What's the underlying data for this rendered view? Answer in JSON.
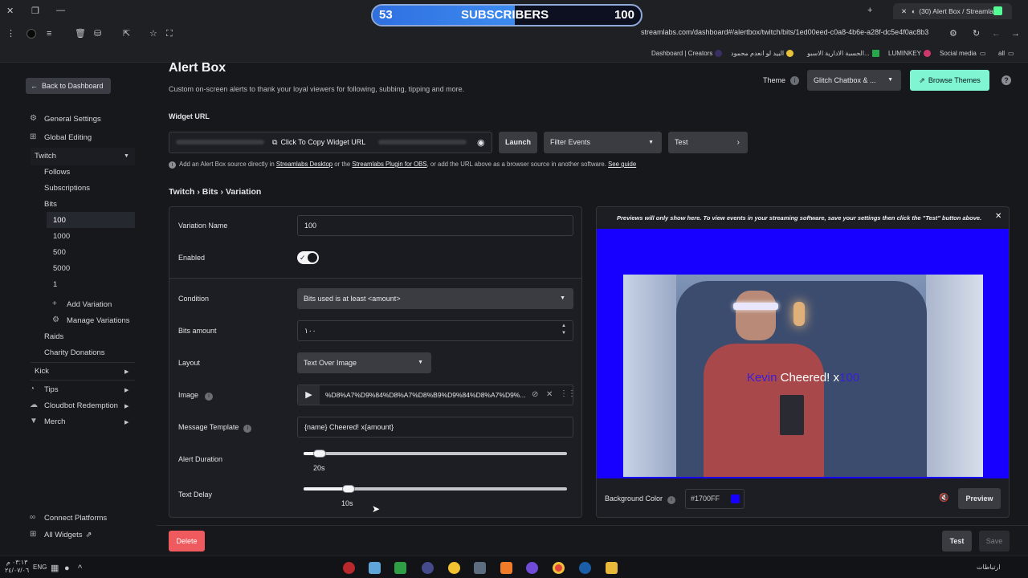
{
  "browser": {
    "tab_title": "(30) Alert Box / Streamlabs",
    "url": "streamlabs.com/dashboard#/alertbox/twitch/bits/1ed00eed-c0a8-4b6e-a28f-dc5e4f0ac8b3",
    "bookmarks": [
      "Dashboard | Creators",
      "البيد لو انعدم محمود",
      "الحسبة الادارية الاسبو...",
      "LUMINKEY",
      "Social media",
      "all"
    ]
  },
  "overlay": {
    "current": "53",
    "label": "SUBSCRIBERS",
    "goal": "100",
    "progress": 0.53
  },
  "sidebar": {
    "back": "Back to Dashboard",
    "general": "General Settings",
    "global": "Global Editing",
    "twitch": "Twitch",
    "follows": "Follows",
    "subscriptions": "Subscriptions",
    "bits": "Bits",
    "variations": [
      "100",
      "1000",
      "500",
      "5000",
      "1"
    ],
    "add_variation": "Add Variation",
    "manage_variations": "Manage Variations",
    "raids": "Raids",
    "charity": "Charity Donations",
    "kick": "Kick",
    "tips": "Tips",
    "cloudbot": "Cloudbot Redemption",
    "merch": "Merch",
    "connect": "Connect Platforms",
    "all_widgets": "All Widgets"
  },
  "header": {
    "title": "Alert Box",
    "description": "Custom on-screen alerts to thank your loyal viewers for following, subbing, tipping and more.",
    "theme_label": "Theme",
    "theme_value": "Glitch Chatbox & ...",
    "browse_themes": "Browse Themes"
  },
  "widget": {
    "label": "Widget URL",
    "copy": "Click To Copy Widget URL",
    "launch": "Launch",
    "filter": "Filter Events",
    "test": "Test",
    "info_1": "Add an Alert Box source directly in ",
    "link_desktop": "Streamlabs Desktop",
    "info_2": " or the ",
    "link_plugin": "Streamlabs Plugin for OBS",
    "info_3": ", or add the URL above as a browser source in another software. ",
    "link_guide": "See guide"
  },
  "breadcrumb": "Twitch › Bits › Variation",
  "form": {
    "variation_name_label": "Variation Name",
    "variation_name": "100",
    "enabled_label": "Enabled",
    "condition_label": "Condition",
    "condition": "Bits used is at least <amount>",
    "bits_amount_label": "Bits amount",
    "bits_amount": "١٠٠",
    "layout_label": "Layout",
    "layout": "Text Over Image",
    "image_label": "Image",
    "image_value": "%D8%A7%D9%84%D8%A7%D8%B9%D9%84%D8%A7%D9%...",
    "message_label": "Message Template",
    "message": "{name} Cheered! x{amount}",
    "duration_label": "Alert Duration",
    "duration": "20s",
    "duration_fraction": 0.06,
    "delay_label": "Text Delay",
    "delay": "10s",
    "delay_fraction": 0.17
  },
  "preview": {
    "notice": "Previews will only show here. To view events in your streaming software, save your settings then click the \"Test\" button above.",
    "alert_name": "Kevin",
    "alert_text": " Cheered! x",
    "alert_amount": "100",
    "bg_label": "Background Color",
    "bg_value": "#1700FF",
    "preview_btn": "Preview"
  },
  "footer": {
    "delete": "Delete",
    "test": "Test",
    "save": "Save"
  },
  "taskbar": {
    "time": "٠٣:١٣ م",
    "date": "٢٤/٠٧/٠٦",
    "lang": "ENG",
    "network": "ارتباطات"
  }
}
